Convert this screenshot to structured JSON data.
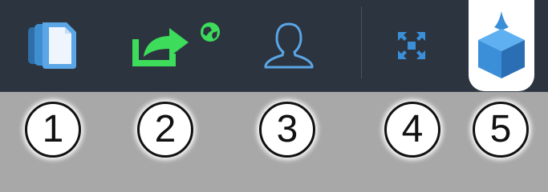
{
  "toolbar": {
    "background": "#2c3440",
    "tools": [
      {
        "icon": "pages-icon",
        "color": "#5aa6e6"
      },
      {
        "icon": "share-web-icon",
        "color": "#3ddc5a"
      },
      {
        "icon": "user-icon",
        "color": "#5aa6e6"
      },
      {
        "icon": "fullscreen-icon",
        "color": "#3a8fd8"
      },
      {
        "icon": "cube-logo-icon",
        "color": "#3a8fd8"
      }
    ]
  },
  "callouts": [
    "1",
    "2",
    "3",
    "4",
    "5"
  ]
}
